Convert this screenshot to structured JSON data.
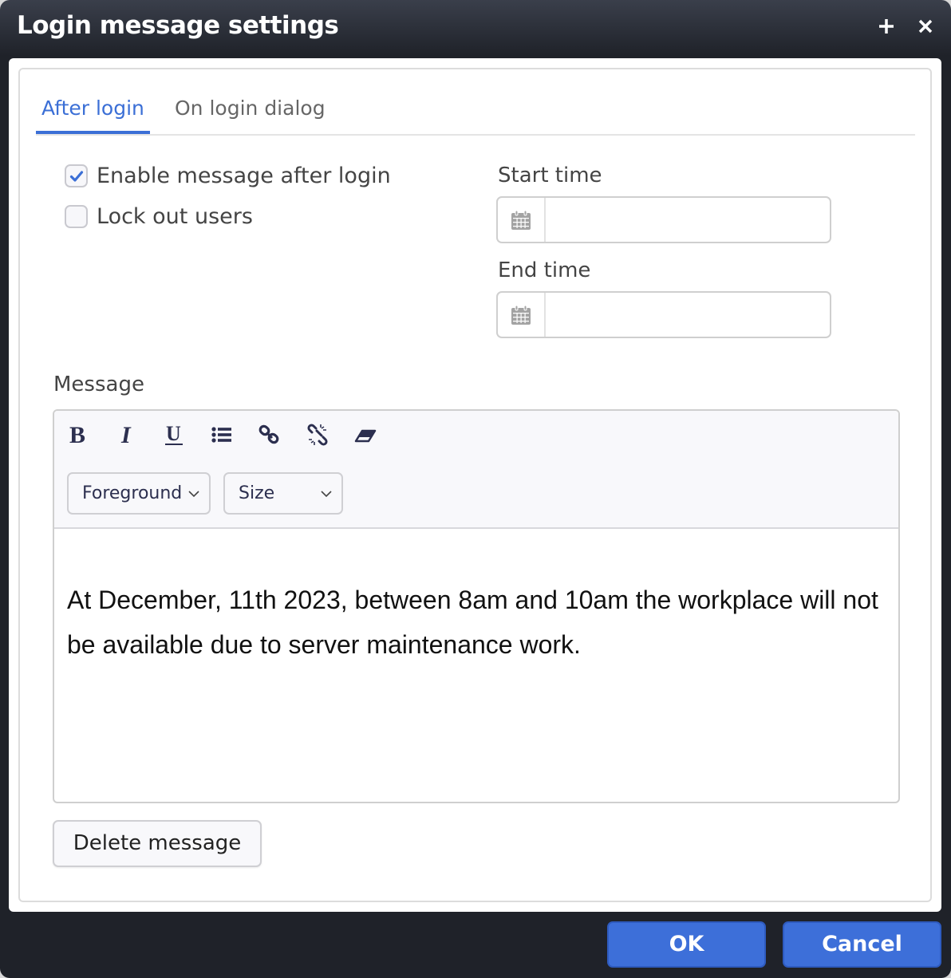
{
  "window": {
    "title": "Login message settings",
    "add_icon": "plus-icon",
    "close_icon": "close-icon"
  },
  "tabs": [
    {
      "label": "After login",
      "active": true
    },
    {
      "label": "On login dialog",
      "active": false
    }
  ],
  "options": {
    "enable_message": {
      "label": "Enable message after login",
      "checked": true
    },
    "lock_out_users": {
      "label": "Lock out users",
      "checked": false
    }
  },
  "schedule": {
    "start_time": {
      "label": "Start time",
      "value": "",
      "icon": "calendar-icon"
    },
    "end_time": {
      "label": "End time",
      "value": "",
      "icon": "calendar-icon"
    }
  },
  "message": {
    "label": "Message",
    "toolbar": {
      "buttons": [
        "bold",
        "italic",
        "underline",
        "bulleted-list",
        "link",
        "unlink",
        "clear-formatting"
      ],
      "foreground_select": "Foreground",
      "size_select": "Size"
    },
    "content": "At December, 11th 2023, between 8am and 10am the workplace will not be available due to server maintenance work."
  },
  "actions": {
    "delete_message": "Delete message",
    "ok": "OK",
    "cancel": "Cancel"
  },
  "colors": {
    "accent": "#3b6fd6",
    "button_primary": "#3d6fd9",
    "titlebar": "#1f2229"
  }
}
